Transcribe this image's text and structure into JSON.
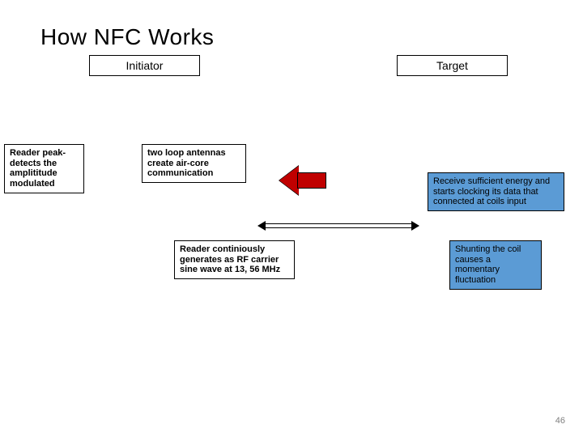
{
  "title": "How NFC Works",
  "headers": {
    "initiator": "Initiator",
    "target": "Target"
  },
  "boxes": {
    "reader_peak": "Reader peak-detects the amplititude modulated",
    "two_loop": "two loop antennas create air-core communication",
    "reader_cont": "Reader continiously generates as RF carrier sine wave at 13, 56 MHz",
    "receive": "Receive sufficient energy and starts clocking its data that connected at coils input",
    "shunting": "Shunting the coil causes a momentary fluctuation"
  },
  "page_number": "46",
  "icons": {
    "red_arrow": "arrow-left-icon",
    "dbl_arrow": "double-arrow-icon"
  }
}
